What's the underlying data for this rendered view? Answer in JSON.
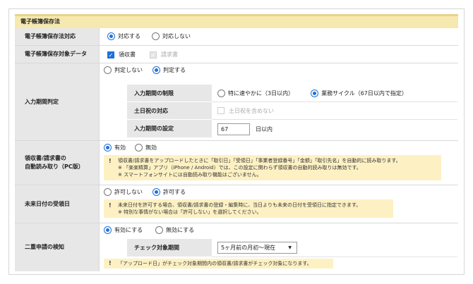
{
  "section_title": "電子帳簿保存法",
  "rows": {
    "compliance": {
      "label": "電子帳簿保存法対応",
      "opt_yes": "対応する",
      "opt_no": "対応しない",
      "selected": "yes"
    },
    "target": {
      "label": "電子帳簿保存対象データ",
      "receipt": "領収書",
      "invoice": "請求書"
    },
    "period": {
      "label": "入力期間判定",
      "opt_no": "判定しない",
      "opt_yes": "判定する",
      "limit_label": "入力期間の制限",
      "limit_opt1": "特に速やかに（3日以内）",
      "limit_opt2": "業務サイクル（67日以内で指定）",
      "holiday_label": "土日祝の対応",
      "holiday_opt": "土日祝を含めない",
      "setting_label": "入力期間の設定",
      "setting_value": "67",
      "setting_unit": "日以内"
    },
    "autoread": {
      "label1": "領収書/請求書の",
      "label2": "自動読み取り（PC版）",
      "opt_on": "有効",
      "opt_off": "無効",
      "note_line1": "領収書/請求書をアップロードしたときに「取引日」「受領日」「事業者登録番号」「金額」「取引先名」を自動的に読み取ります。",
      "note_line2": "※ 「楽楽精算」アプリ（iPhone / Android）では、この設定に関わらず領収書の自動的読み取りは無効です。",
      "note_line3": "※ スマートフォンサイトには自動読み取り機能はございません。"
    },
    "future": {
      "label": "未来日付の受領日",
      "opt_no": "許可しない",
      "opt_yes": "許可する",
      "note_line1": "未来日付を許可する場合、領収書/請求書の登録・編集時に、当日よりも未来の日付を受領日に指定できます。",
      "note_line2": "※ 特別な事情がない場合は「許可しない」を選択してください。"
    },
    "duplicate": {
      "label": "二重申請の検知",
      "opt_on": "有効にする",
      "opt_off": "無効にする",
      "period_label": "チェック対象期間",
      "period_value": "5ヶ月前の月初〜現在",
      "note": "「アップロード日」がチェック対象期間内の領収書/請求書がチェック対象になります。"
    }
  },
  "colors": {
    "accent": "#1e6fd9",
    "note_bg": "#fdf1c4",
    "title_bg": "#f5e9b0"
  }
}
